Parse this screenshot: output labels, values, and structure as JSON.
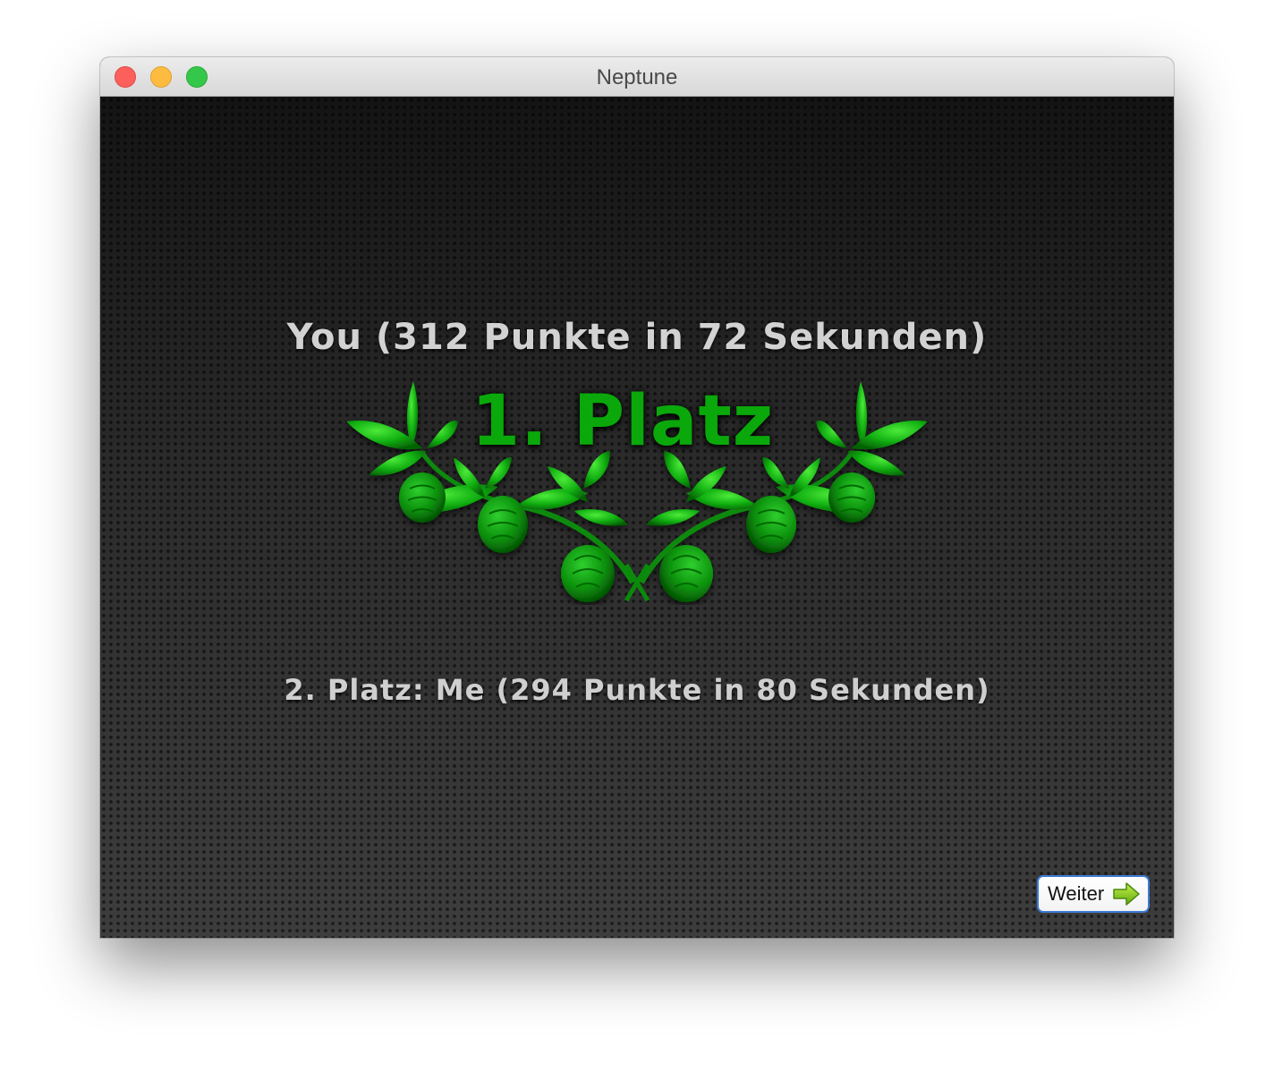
{
  "window": {
    "title": "Neptune"
  },
  "result": {
    "winner_line": "You (312 Punkte in 72 Sekunden)",
    "first_place_label": "1. Platz",
    "runner_up_line": "2. Platz: Me (294 Punkte in 80 Sekunden)"
  },
  "buttons": {
    "next_label": "Weiter",
    "next_icon": "arrow-right-icon"
  },
  "colors": {
    "first_place": "#0aa80a",
    "leaves": "#14b414",
    "background": "#2a2a2a",
    "button_border": "#3d7bd6"
  }
}
